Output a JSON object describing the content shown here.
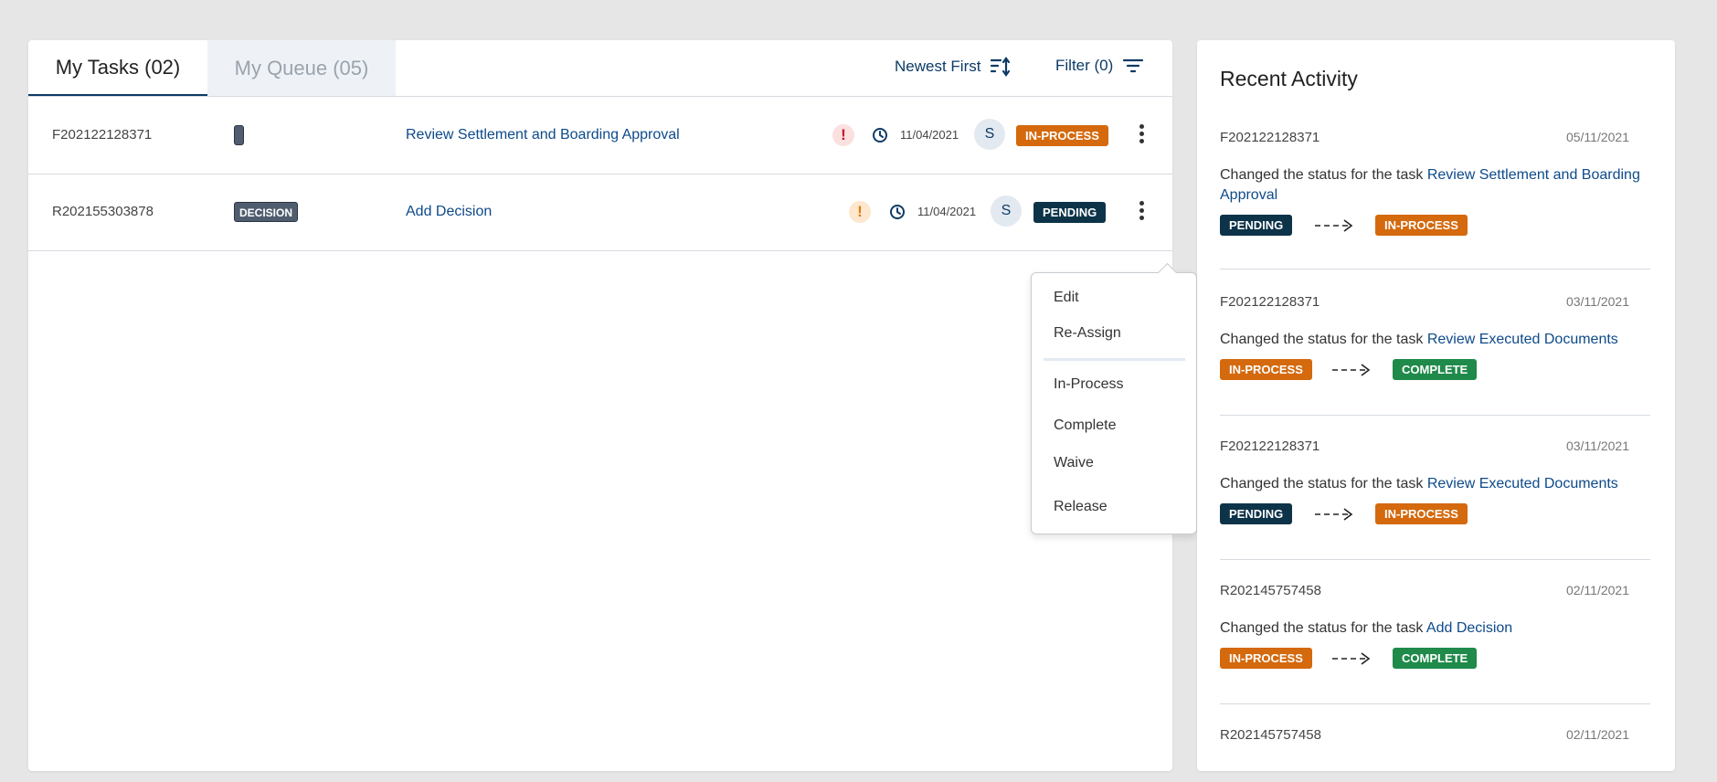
{
  "tasks_panel": {
    "tabs": [
      {
        "label": "My Tasks (02)",
        "active": true
      },
      {
        "label": "My Queue (05)",
        "active": false
      }
    ],
    "sort_label": "Newest First",
    "filter_label": "Filter (0)",
    "rows": [
      {
        "id": "F202122128371",
        "type_tag": "",
        "task": "Review Settlement and Boarding Approval",
        "priority": "high",
        "due": "11/04/2021",
        "assignee": "S",
        "status": "IN-PROCESS"
      },
      {
        "id": "R202155303878",
        "type_tag": "DECISION",
        "task": "Add Decision",
        "priority": "medium",
        "due": "11/04/2021",
        "assignee": "S",
        "status": "PENDING"
      }
    ],
    "row_menu": {
      "items_top": [
        "Edit",
        "Re-Assign"
      ],
      "items_bottom": [
        "In-Process",
        "Complete",
        "Waive",
        "Release"
      ]
    }
  },
  "activity_panel": {
    "title": "Recent Activity",
    "desc_prefix": "Changed the status for the task",
    "items": [
      {
        "id": "F202122128371",
        "date": "05/11/2021",
        "task": "Review Settlement and Boarding Approval",
        "from": "PENDING",
        "to": "IN-PROCESS"
      },
      {
        "id": "F202122128371",
        "date": "03/11/2021",
        "task": "Review Executed Documents",
        "from": "IN-PROCESS",
        "to": "COMPLETE"
      },
      {
        "id": "F202122128371",
        "date": "03/11/2021",
        "task": "Review Executed Documents",
        "from": "PENDING",
        "to": "IN-PROCESS"
      },
      {
        "id": "R202145757458",
        "date": "02/11/2021",
        "task": "Add Decision",
        "from": "IN-PROCESS",
        "to": "COMPLETE"
      },
      {
        "id": "R202145757458",
        "date": "02/11/2021"
      }
    ]
  },
  "icons": {
    "sort": "sort-icon",
    "filter": "filter-icon",
    "priority": "exclamation-icon",
    "due": "clock-icon",
    "menu": "kebab-icon",
    "arrow": "dashed-arrow-icon"
  },
  "colors": {
    "link": "#0d4a8a",
    "in_process": "#d4690d",
    "pending": "#0d3348",
    "complete": "#1f8a4a",
    "priority_high": "#c8102e",
    "priority_medium": "#e07b10"
  }
}
